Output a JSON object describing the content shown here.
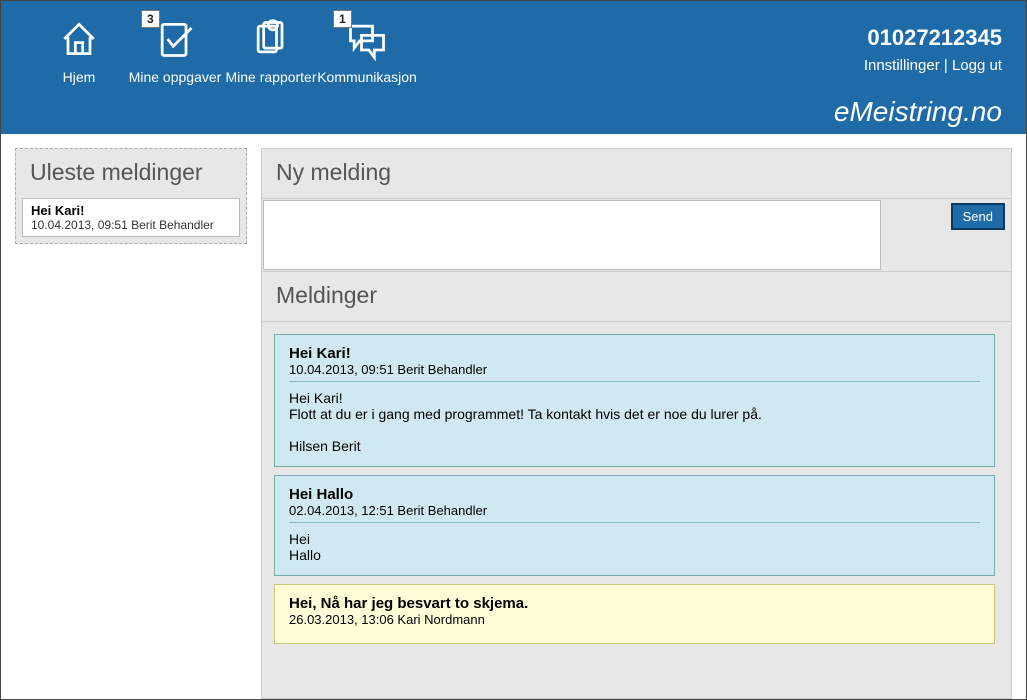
{
  "header": {
    "nav": [
      {
        "key": "home",
        "label": "Hjem",
        "badge": null
      },
      {
        "key": "tasks",
        "label": "Mine oppgaver",
        "badge": "3"
      },
      {
        "key": "reports",
        "label": "Mine rapporter",
        "badge": null
      },
      {
        "key": "comm",
        "label": "Kommunikasjon",
        "badge": "1"
      }
    ],
    "user_id": "01027212345",
    "settings_label": "Innstillinger",
    "logout_label": "Logg ut",
    "brand_prefix": "e",
    "brand_rest": "Meistring.no"
  },
  "sidebar": {
    "title": "Uleste meldinger",
    "items": [
      {
        "subject": "Hei Kari!",
        "meta": "10.04.2013, 09:51 Berit Behandler"
      }
    ]
  },
  "compose": {
    "title": "Ny melding",
    "send_label": "Send",
    "value": ""
  },
  "messages": {
    "title": "Meldinger",
    "list": [
      {
        "kind": "therapist",
        "subject": "Hei Kari!",
        "meta": "10.04.2013, 09:51 Berit Behandler",
        "body": "Hei Kari!\nFlott at du er i gang med programmet! Ta kontakt hvis det er noe du lurer på.\n\nHilsen Berit"
      },
      {
        "kind": "therapist",
        "subject": "Hei Hallo",
        "meta": "02.04.2013, 12:51 Berit Behandler",
        "body": "Hei\nHallo"
      },
      {
        "kind": "patient",
        "subject": "Hei, Nå har jeg besvart to skjema.",
        "meta": "26.03.2013, 13:06 Kari Nordmann",
        "body": ""
      }
    ]
  }
}
